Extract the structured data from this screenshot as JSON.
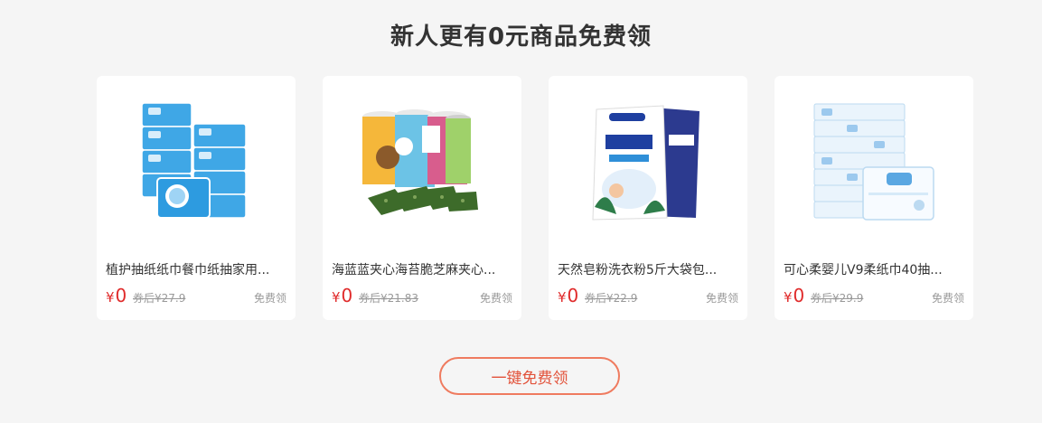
{
  "page": {
    "title": "新人更有0元商品免费领"
  },
  "products": [
    {
      "image_icon": "tissue-pack-image",
      "name": "植护抽纸纸巾餐巾纸抽家用...",
      "currency": "¥",
      "price": "0",
      "original_price": "券后¥27.9",
      "action": "免费领"
    },
    {
      "image_icon": "seaweed-snack-image",
      "name": "海蓝蓝夹心海苔脆芝麻夹心...",
      "currency": "¥",
      "price": "0",
      "original_price": "券后¥21.83",
      "action": "免费领"
    },
    {
      "image_icon": "laundry-powder-image",
      "name": "天然皂粉洗衣粉5斤大袋包...",
      "currency": "¥",
      "price": "0",
      "original_price": "券后¥22.9",
      "action": "免费领"
    },
    {
      "image_icon": "baby-tissue-image",
      "name": "可心柔婴儿V9柔纸巾40抽...",
      "currency": "¥",
      "price": "0",
      "original_price": "券后¥29.9",
      "action": "免费领"
    }
  ],
  "cta": {
    "label": "一键免费领"
  },
  "colors": {
    "accent": "#e02b2b",
    "button_border": "#ef7b5f",
    "button_text": "#e2523a"
  }
}
